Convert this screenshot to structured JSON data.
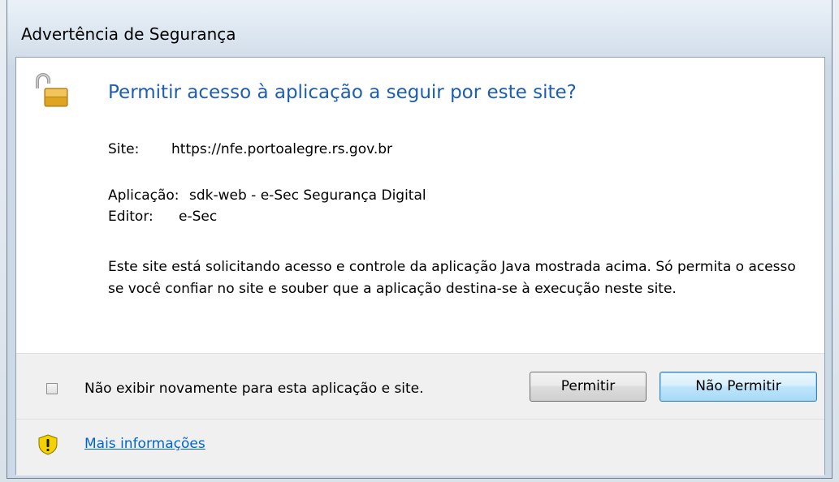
{
  "window": {
    "title": "Advertência de Segurança"
  },
  "dialog": {
    "heading": "Permitir acesso à aplicação a seguir por este site?",
    "site_label": "Site:",
    "site_value": "https://nfe.portoalegre.rs.gov.br",
    "application_label": "Aplicação:",
    "application_value": "sdk-web - e-Sec Segurança Digital",
    "publisher_label": "Editor:",
    "publisher_value": "e-Sec",
    "description": "Este site está solicitando acesso e controle da aplicação Java mostrada acima. Só permita o acesso se você confiar no site e souber que a aplicação destina-se à execução neste site."
  },
  "footer": {
    "checkbox_label": "Não exibir novamente para esta aplicação e site.",
    "checkbox_checked": false,
    "allow_button": "Permitir",
    "deny_button": "Não Permitir",
    "more_info_link": "Mais informações"
  },
  "icons": {
    "lock": "unlocked-padlock-icon",
    "warning": "warning-shield-icon"
  },
  "colors": {
    "heading": "#1e5eb0",
    "link": "#0066cc",
    "lock_body": "#e0a520",
    "warning_yellow": "#f5d100"
  }
}
